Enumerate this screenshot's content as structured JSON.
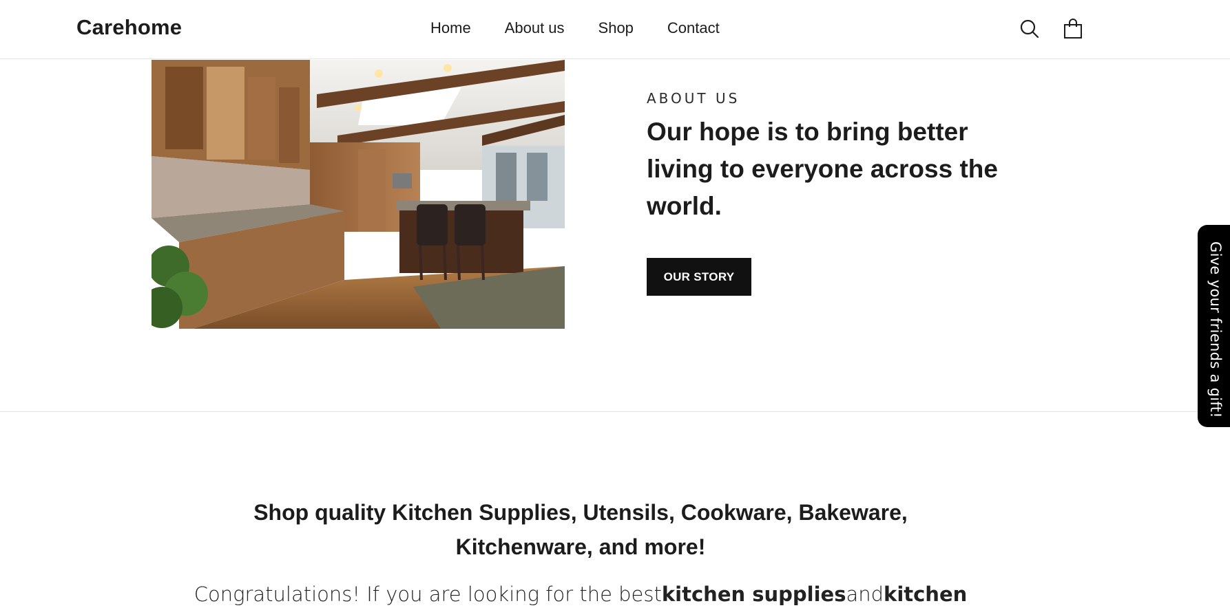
{
  "header": {
    "logo": "Carehome",
    "nav": [
      "Home",
      "About us",
      "Shop",
      "Contact"
    ],
    "icons": [
      "search-icon",
      "cart-icon"
    ]
  },
  "about": {
    "image": "kitchen-photo",
    "eyebrow": "ABOUT US",
    "headline": "Our hope is to bring better living to everyone across the world.",
    "button_label": "OUR STORY"
  },
  "shop": {
    "title_line1": "Shop quality Kitchen Supplies, Utensils, Cookware, Bakeware,",
    "title_line2": "Kitchenware, and more!",
    "text_prefix": "Congratulations! If you are looking for the best",
    "text_bold1": "kitchen supplies",
    "text_mid": "and",
    "text_bold2": "kitchen"
  },
  "gift_tab": {
    "label": "Give your friends a gift!"
  },
  "colors": {
    "button_bg": "#111111",
    "tab_bg": "#000000",
    "text": "#1c1c1c"
  }
}
